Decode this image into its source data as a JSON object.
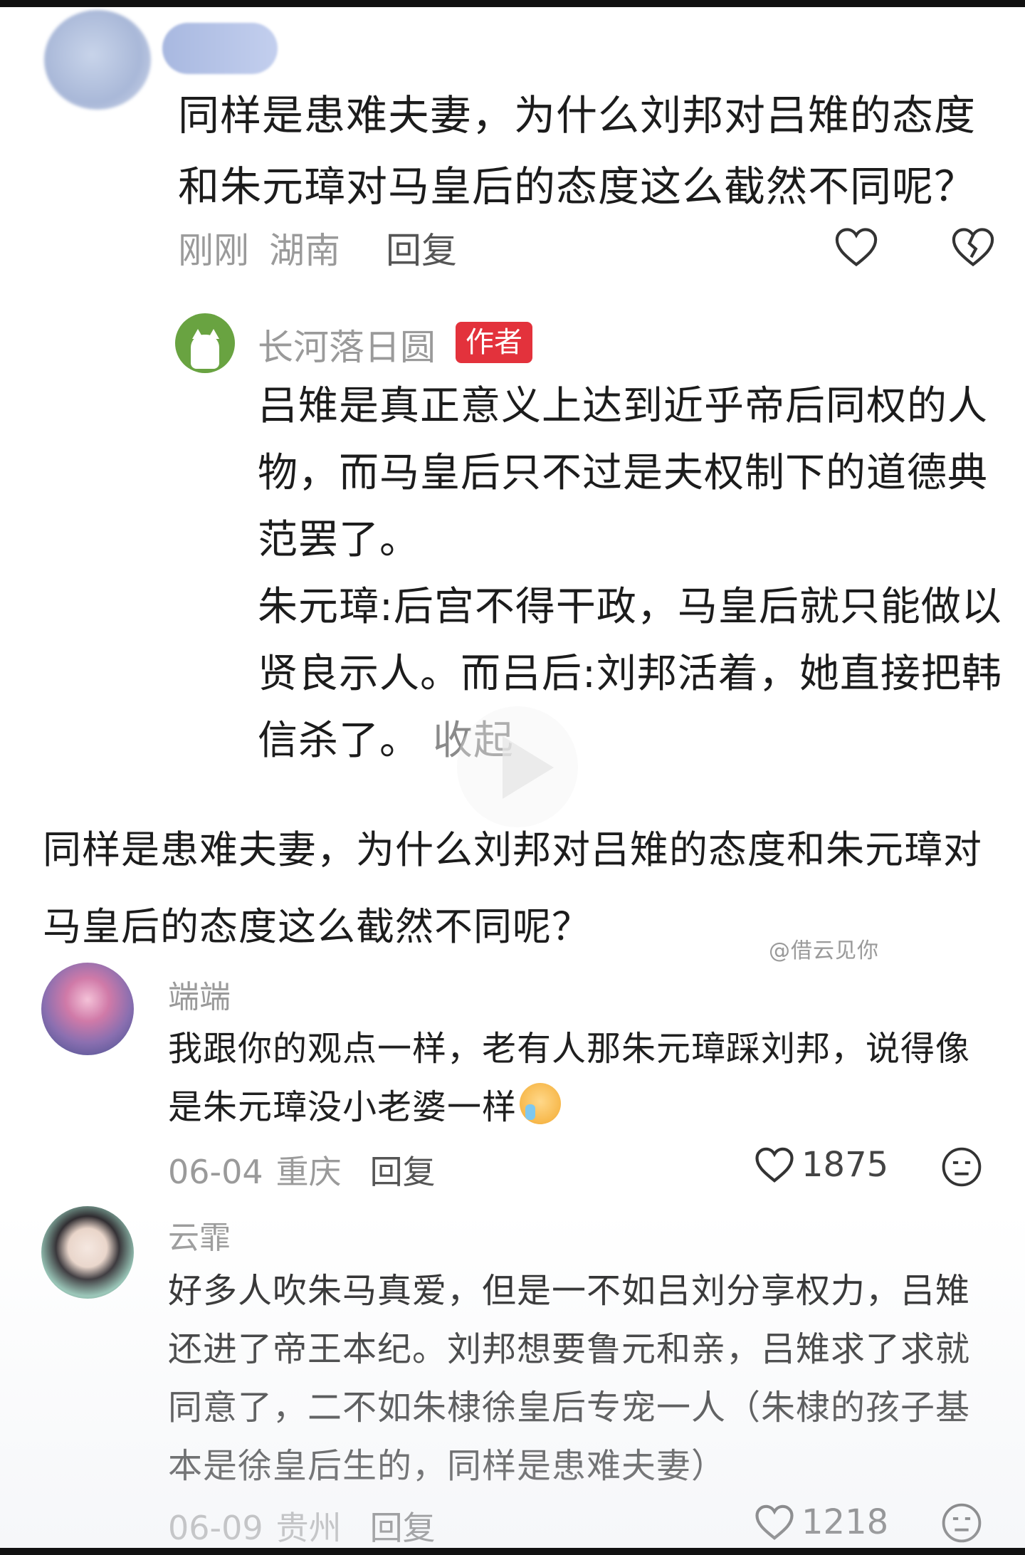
{
  "post_comment": {
    "text": "同样是患难夫妻，为什么刘邦对吕雉的态度和朱元璋对马皇后的态度这么截然不同呢？",
    "time": "刚刚",
    "location": "湖南",
    "reply_label": "回复"
  },
  "author_reply": {
    "name": "长河落日圆",
    "tag": "作者",
    "line1": "吕雉是真正意义上达到近乎帝后同权的人物，而马皇后只不过是夫权制下的道德典范罢了。",
    "line2": "朱元璋:后宫不得干政，马皇后就只能做以贤良示人。而吕后:刘邦活着，她直接把韩信杀了。",
    "collapse_label": "收起"
  },
  "video_title": "同样是患难夫妻，为什么刘邦对吕雉的态度和朱元璋对马皇后的态度这么截然不同呢？",
  "watermark": "@借云见你",
  "comments": [
    {
      "name": "端端",
      "text": "我跟你的观点一样，老有人那朱元璋踩刘邦，说得像是朱元璋没小老婆一样",
      "date": "06-04",
      "location": "重庆",
      "reply_label": "回复",
      "likes": "1875"
    },
    {
      "name": "云霏",
      "text": "好多人吹朱马真爱，但是一不如吕刘分享权力，吕雉还进了帝王本纪。刘邦想要鲁元和亲，吕雉求了求就同意了，二不如朱棣徐皇后专宠一人（朱棣的孩子基本是徐皇后生的，同样是患难夫妻）",
      "date": "06-09",
      "location": "贵州",
      "reply_label": "回复",
      "likes": "1218"
    }
  ],
  "colors": {
    "author_tag": "#e3323c",
    "meta_gray": "#9a9a9a"
  }
}
